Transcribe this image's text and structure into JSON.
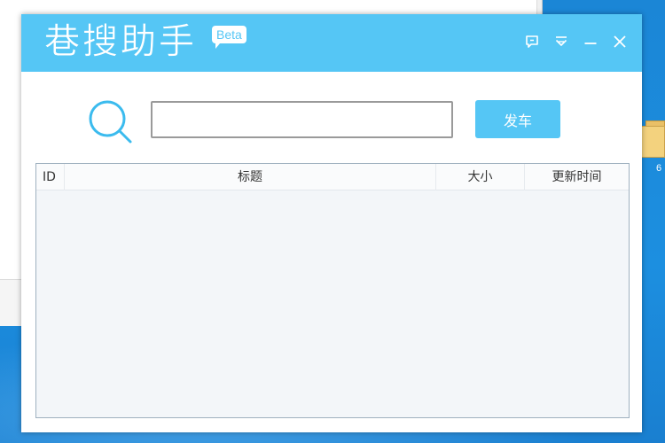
{
  "app": {
    "title": "巷搜助手",
    "badge": "Beta",
    "accent_color": "#55c6f5"
  },
  "window_controls": [
    {
      "name": "feedback-icon",
      "icon": "speech-bubble"
    },
    {
      "name": "menu-icon",
      "icon": "chevron-down-lines"
    },
    {
      "name": "minimize-icon",
      "icon": "minus"
    },
    {
      "name": "close-icon",
      "icon": "x"
    }
  ],
  "search": {
    "value": "",
    "placeholder": "",
    "button_label": "发车"
  },
  "table": {
    "columns": [
      "ID",
      "标题",
      "大小",
      "更新时间"
    ],
    "rows": []
  },
  "desktop": {
    "folder_label": "6"
  }
}
